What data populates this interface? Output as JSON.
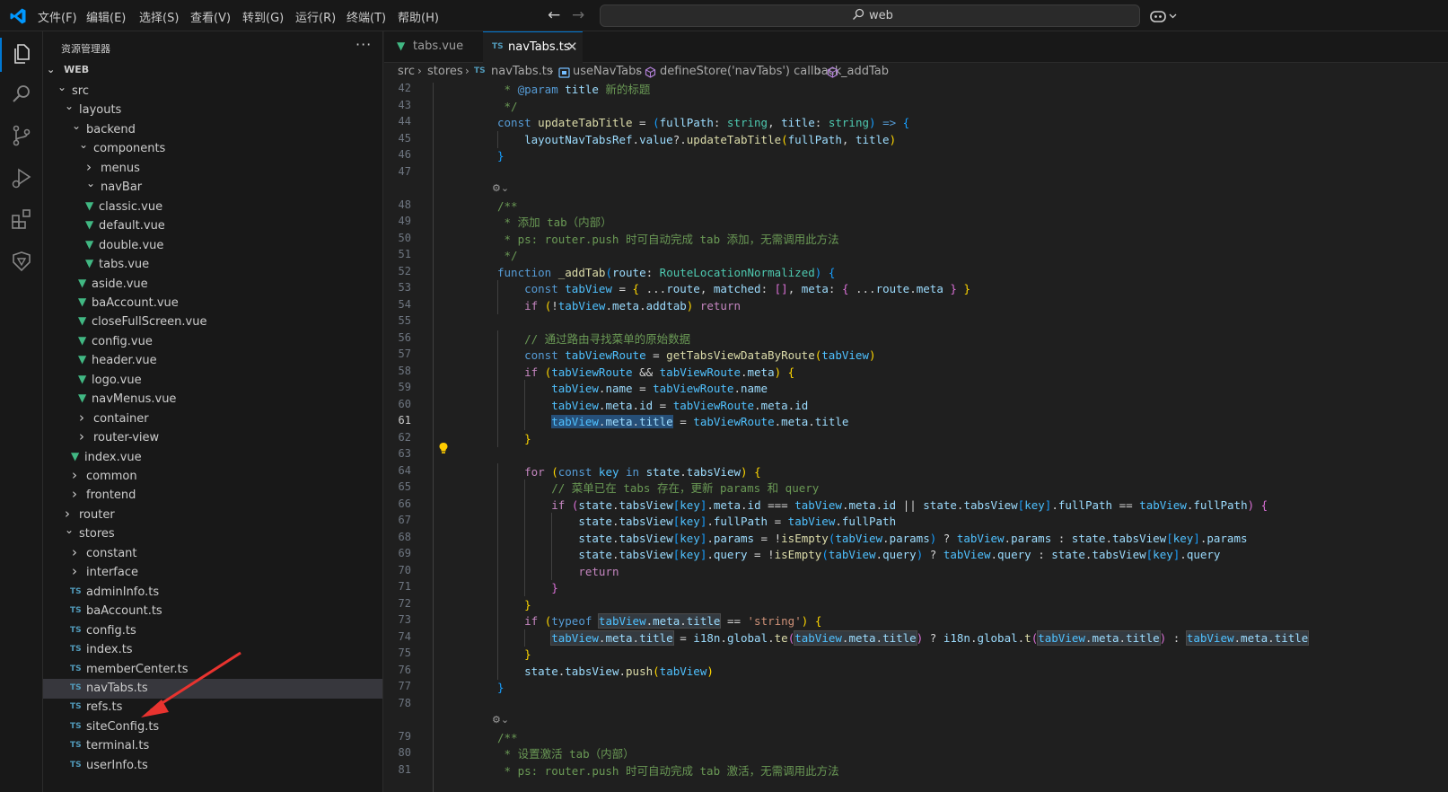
{
  "titlebar": {
    "menus": [
      "文件(F)",
      "编辑(E)",
      "选择(S)",
      "查看(V)",
      "转到(G)",
      "运行(R)",
      "终端(T)",
      "帮助(H)"
    ],
    "command_center": "web"
  },
  "sidebar": {
    "title": "资源管理器",
    "more": "···",
    "root": "WEB",
    "items": [
      {
        "label": "src",
        "kind": "folder-open",
        "depth": 0
      },
      {
        "label": "layouts",
        "kind": "folder-open",
        "depth": 1
      },
      {
        "label": "backend",
        "kind": "folder-open",
        "depth": 2
      },
      {
        "label": "components",
        "kind": "folder-open",
        "depth": 3
      },
      {
        "label": "menus",
        "kind": "folder-closed",
        "depth": 4
      },
      {
        "label": "navBar",
        "kind": "folder-open",
        "depth": 4
      },
      {
        "label": "classic.vue",
        "kind": "vue",
        "depth": 5
      },
      {
        "label": "default.vue",
        "kind": "vue",
        "depth": 5
      },
      {
        "label": "double.vue",
        "kind": "vue",
        "depth": 5
      },
      {
        "label": "tabs.vue",
        "kind": "vue",
        "depth": 5
      },
      {
        "label": "aside.vue",
        "kind": "vue",
        "depth": 4
      },
      {
        "label": "baAccount.vue",
        "kind": "vue",
        "depth": 4
      },
      {
        "label": "closeFullScreen.vue",
        "kind": "vue",
        "depth": 4
      },
      {
        "label": "config.vue",
        "kind": "vue",
        "depth": 4
      },
      {
        "label": "header.vue",
        "kind": "vue",
        "depth": 4
      },
      {
        "label": "logo.vue",
        "kind": "vue",
        "depth": 4
      },
      {
        "label": "navMenus.vue",
        "kind": "vue",
        "depth": 4
      },
      {
        "label": "container",
        "kind": "folder-closed",
        "depth": 3
      },
      {
        "label": "router-view",
        "kind": "folder-closed",
        "depth": 3
      },
      {
        "label": "index.vue",
        "kind": "vue",
        "depth": 3
      },
      {
        "label": "common",
        "kind": "folder-closed",
        "depth": 2
      },
      {
        "label": "frontend",
        "kind": "folder-closed",
        "depth": 2
      },
      {
        "label": "router",
        "kind": "folder-closed",
        "depth": 1
      },
      {
        "label": "stores",
        "kind": "folder-open",
        "depth": 1
      },
      {
        "label": "constant",
        "kind": "folder-closed",
        "depth": 2
      },
      {
        "label": "interface",
        "kind": "folder-closed",
        "depth": 2
      },
      {
        "label": "adminInfo.ts",
        "kind": "ts",
        "depth": 2
      },
      {
        "label": "baAccount.ts",
        "kind": "ts",
        "depth": 2
      },
      {
        "label": "config.ts",
        "kind": "ts",
        "depth": 2
      },
      {
        "label": "index.ts",
        "kind": "ts",
        "depth": 2
      },
      {
        "label": "memberCenter.ts",
        "kind": "ts",
        "depth": 2
      },
      {
        "label": "navTabs.ts",
        "kind": "ts",
        "depth": 2,
        "selected": true
      },
      {
        "label": "refs.ts",
        "kind": "ts",
        "depth": 2
      },
      {
        "label": "siteConfig.ts",
        "kind": "ts",
        "depth": 2
      },
      {
        "label": "terminal.ts",
        "kind": "ts",
        "depth": 2
      },
      {
        "label": "userInfo.ts",
        "kind": "ts",
        "depth": 2
      }
    ]
  },
  "tabs": [
    {
      "label": "tabs.vue",
      "icon": "vue",
      "active": false
    },
    {
      "label": "navTabs.ts",
      "icon": "TS",
      "active": true
    }
  ],
  "breadcrumb": [
    "src",
    "stores",
    "navTabs.ts",
    "useNavTabs",
    "defineStore('navTabs') callback",
    "_addTab"
  ],
  "ts_icon_text": "TS",
  "editor": {
    "current_line": 61,
    "lines": [
      {
        "n": 42,
        "html": "<span class=\"cm\"> * <span class=\"cmtag\">@param</span> <span class=\"var\">title</span> 新的标题</span>"
      },
      {
        "n": 43,
        "html": "<span class=\"cm\"> */</span>"
      },
      {
        "n": 44,
        "html": "<span class=\"kw\">const</span> <span class=\"fn\">updateTabTitle</span> = <span class=\"p3\">(</span><span class=\"var\">fullPath</span>: <span class=\"typ\">string</span>, <span class=\"var\">title</span>: <span class=\"typ\">string</span><span class=\"p3\">)</span> <span class=\"kw\">=&gt;</span> <span class=\"p3\">{</span>"
      },
      {
        "n": 45,
        "html": "    <span class=\"var\">layoutNavTabsRef</span>.<span class=\"var\">value</span>?.<span class=\"fn\">updateTabTitle</span><span class=\"p1\">(</span><span class=\"var\">fullPath</span>, <span class=\"var\">title</span><span class=\"p1\">)</span>"
      },
      {
        "n": 46,
        "html": "<span class=\"p3\">}</span>"
      },
      {
        "n": 47,
        "html": ""
      },
      {
        "n": 48,
        "html": "<span class=\"cm\">/**</span>",
        "lens": true
      },
      {
        "n": 49,
        "html": "<span class=\"cm\"> * 添加 tab（内部）</span>"
      },
      {
        "n": 50,
        "html": "<span class=\"cm\"> * ps: router.push 时可自动完成 tab 添加，无需调用此方法</span>"
      },
      {
        "n": 51,
        "html": "<span class=\"cm\"> */</span>"
      },
      {
        "n": 52,
        "html": "<span class=\"kw\">function</span> <span class=\"fn\">_addTab</span><span class=\"p3\">(</span><span class=\"var\">route</span>: <span class=\"typ\">RouteLocationNormalized</span><span class=\"p3\">)</span> <span class=\"p3\">{</span>"
      },
      {
        "n": 53,
        "html": "    <span class=\"kw\">const</span> <span class=\"cst\">tabView</span> = <span class=\"p1\">{</span> ...<span class=\"var\">route</span>, <span class=\"var\">matched</span>: <span class=\"p2\">[]</span>, <span class=\"var\">meta</span>: <span class=\"p2\">{</span> ...<span class=\"var\">route</span>.<span class=\"var\">meta</span> <span class=\"p2\">}</span> <span class=\"p1\">}</span>"
      },
      {
        "n": 54,
        "html": "    <span class=\"ctl\">if</span> <span class=\"p1\">(</span>!<span class=\"cst\">tabView</span>.<span class=\"var\">meta</span>.<span class=\"var\">addtab</span><span class=\"p1\">)</span> <span class=\"ctl\">return</span>"
      },
      {
        "n": 55,
        "html": ""
      },
      {
        "n": 56,
        "html": "    <span class=\"cm\">// 通过路由寻找菜单的原始数据</span>"
      },
      {
        "n": 57,
        "html": "    <span class=\"kw\">const</span> <span class=\"cst\">tabViewRoute</span> = <span class=\"fn\">getTabsViewDataByRoute</span><span class=\"p1\">(</span><span class=\"cst\">tabView</span><span class=\"p1\">)</span>"
      },
      {
        "n": 58,
        "html": "    <span class=\"ctl\">if</span> <span class=\"p1\">(</span><span class=\"cst\">tabViewRoute</span> &amp;&amp; <span class=\"cst\">tabViewRoute</span>.<span class=\"var\">meta</span><span class=\"p1\">)</span> <span class=\"p1\">{</span>"
      },
      {
        "n": 59,
        "html": "        <span class=\"cst\">tabView</span>.<span class=\"var\">name</span> = <span class=\"cst\">tabViewRoute</span>.<span class=\"var\">name</span>"
      },
      {
        "n": 60,
        "html": "        <span class=\"cst\">tabView</span>.<span class=\"var\">meta</span>.<span class=\"var\">id</span> = <span class=\"cst\">tabViewRoute</span>.<span class=\"var\">meta</span>.<span class=\"var\">id</span>"
      },
      {
        "n": 61,
        "html": "        <span class=\"hl\"><span class=\"cst\">tabView</span>.<span class=\"var\">meta</span>.<span class=\"var\">title</span></span> = <span class=\"cst\">tabViewRoute</span>.<span class=\"var\">meta</span>.<span class=\"var\">title</span>"
      },
      {
        "n": 62,
        "html": "    <span class=\"p1\">}</span>"
      },
      {
        "n": 63,
        "html": ""
      },
      {
        "n": 64,
        "html": "    <span class=\"ctl\">for</span> <span class=\"p1\">(</span><span class=\"kw\">const</span> <span class=\"cst\">key</span> <span class=\"kw\">in</span> <span class=\"var\">state</span>.<span class=\"var\">tabsView</span><span class=\"p1\">)</span> <span class=\"p1\">{</span>"
      },
      {
        "n": 65,
        "html": "        <span class=\"cm\">// 菜单已在 tabs 存在，更新 params 和 query</span>"
      },
      {
        "n": 66,
        "html": "        <span class=\"ctl\">if</span> <span class=\"p2\">(</span><span class=\"var\">state</span>.<span class=\"var\">tabsView</span><span class=\"p3\">[</span><span class=\"cst\">key</span><span class=\"p3\">]</span>.<span class=\"var\">meta</span>.<span class=\"var\">id</span> === <span class=\"cst\">tabView</span>.<span class=\"var\">meta</span>.<span class=\"var\">id</span> || <span class=\"var\">state</span>.<span class=\"var\">tabsView</span><span class=\"p3\">[</span><span class=\"cst\">key</span><span class=\"p3\">]</span>.<span class=\"var\">fullPath</span> == <span class=\"cst\">tabView</span>.<span class=\"var\">fullPath</span><span class=\"p2\">)</span> <span class=\"p2\">{</span>"
      },
      {
        "n": 67,
        "html": "            <span class=\"var\">state</span>.<span class=\"var\">tabsView</span><span class=\"p3\">[</span><span class=\"cst\">key</span><span class=\"p3\">]</span>.<span class=\"var\">fullPath</span> = <span class=\"cst\">tabView</span>.<span class=\"var\">fullPath</span>"
      },
      {
        "n": 68,
        "html": "            <span class=\"var\">state</span>.<span class=\"var\">tabsView</span><span class=\"p3\">[</span><span class=\"cst\">key</span><span class=\"p3\">]</span>.<span class=\"var\">params</span> = !<span class=\"fn\">isEmpty</span><span class=\"p3\">(</span><span class=\"cst\">tabView</span>.<span class=\"var\">params</span><span class=\"p3\">)</span> ? <span class=\"cst\">tabView</span>.<span class=\"var\">params</span> : <span class=\"var\">state</span>.<span class=\"var\">tabsView</span><span class=\"p3\">[</span><span class=\"cst\">key</span><span class=\"p3\">]</span>.<span class=\"var\">params</span>"
      },
      {
        "n": 69,
        "html": "            <span class=\"var\">state</span>.<span class=\"var\">tabsView</span><span class=\"p3\">[</span><span class=\"cst\">key</span><span class=\"p3\">]</span>.<span class=\"var\">query</span> = !<span class=\"fn\">isEmpty</span><span class=\"p3\">(</span><span class=\"cst\">tabView</span>.<span class=\"var\">query</span><span class=\"p3\">)</span> ? <span class=\"cst\">tabView</span>.<span class=\"var\">query</span> : <span class=\"var\">state</span>.<span class=\"var\">tabsView</span><span class=\"p3\">[</span><span class=\"cst\">key</span><span class=\"p3\">]</span>.<span class=\"var\">query</span>"
      },
      {
        "n": 70,
        "html": "            <span class=\"ctl\">return</span>"
      },
      {
        "n": 71,
        "html": "        <span class=\"p2\">}</span>"
      },
      {
        "n": 72,
        "html": "    <span class=\"p1\">}</span>"
      },
      {
        "n": 73,
        "html": "    <span class=\"ctl\">if</span> <span class=\"p1\">(</span><span class=\"kw\">typeof</span> <span class=\"hl2\"><span class=\"cst\">tabView</span>.<span class=\"var\">meta</span>.<span class=\"var\">title</span></span> == <span class=\"str\">'string'</span><span class=\"p1\">)</span> <span class=\"p1\">{</span>"
      },
      {
        "n": 74,
        "html": "        <span class=\"hl2\"><span class=\"cst\">tabView</span>.<span class=\"var\">meta</span>.<span class=\"var\">title</span></span> = <span class=\"var\">i18n</span>.<span class=\"var\">global</span>.<span class=\"fn\">te</span><span class=\"p2\">(</span><span class=\"hl2\"><span class=\"cst\">tabView</span>.<span class=\"var\">meta</span>.<span class=\"var\">title</span></span><span class=\"p2\">)</span> ? <span class=\"var\">i18n</span>.<span class=\"var\">global</span>.<span class=\"fn\">t</span><span class=\"p2\">(</span><span class=\"hl2\"><span class=\"cst\">tabView</span>.<span class=\"var\">meta</span>.<span class=\"var\">title</span></span><span class=\"p2\">)</span> : <span class=\"hl2\"><span class=\"cst\">tabView</span>.<span class=\"var\">meta</span>.<span class=\"var\">title</span></span>"
      },
      {
        "n": 75,
        "html": "    <span class=\"p1\">}</span>"
      },
      {
        "n": 76,
        "html": "    <span class=\"var\">state</span>.<span class=\"var\">tabsView</span>.<span class=\"fn\">push</span><span class=\"p1\">(</span><span class=\"cst\">tabView</span><span class=\"p1\">)</span>"
      },
      {
        "n": 77,
        "html": "<span class=\"p3\">}</span>"
      },
      {
        "n": 78,
        "html": ""
      },
      {
        "n": 79,
        "html": "<span class=\"cm\">/**</span>",
        "lens": true
      },
      {
        "n": 80,
        "html": "<span class=\"cm\"> * 设置激活 tab（内部）</span>"
      },
      {
        "n": 81,
        "html": "<span class=\"cm\"> * ps: router.push 时可自动完成 tab 激活，无需调用此方法</span>"
      }
    ]
  },
  "colors": {
    "accent": "#0078d4",
    "vue_icon": "#41b883",
    "ts_icon": "#519aba",
    "selection": "#264f78",
    "lightbulb": "#ffcc00",
    "annotation_arrow": "#e8332f"
  }
}
